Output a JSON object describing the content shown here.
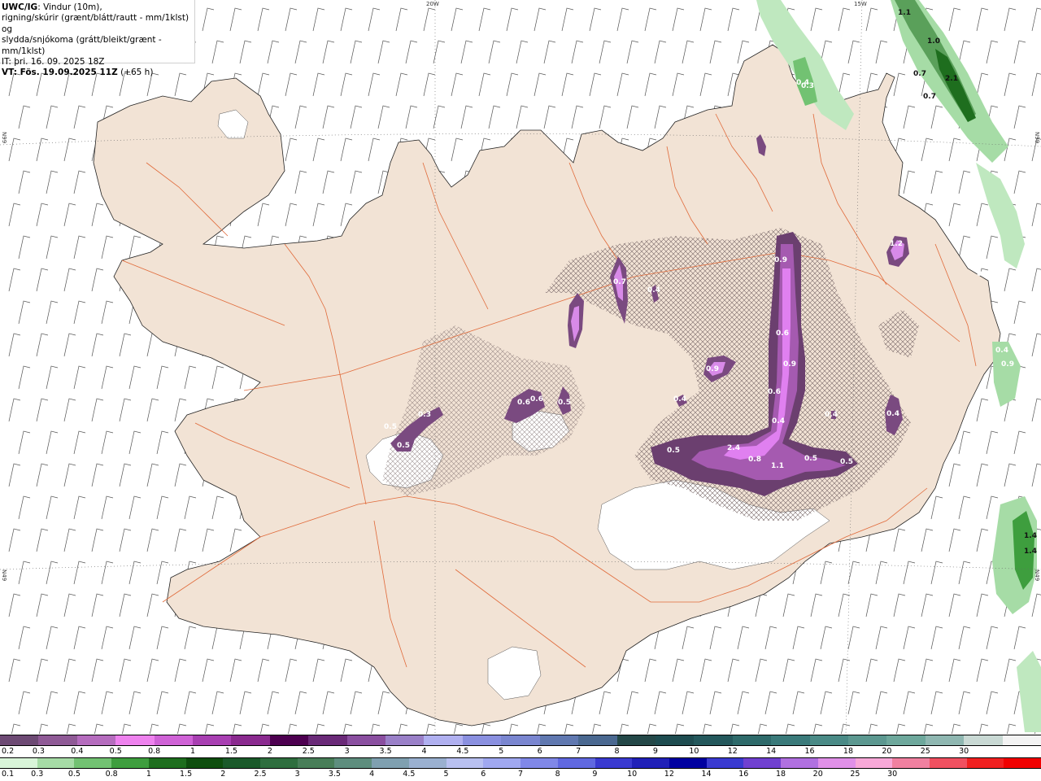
{
  "title": {
    "model": "UWC/IG",
    "line1_rest": ": Vindur (10m),",
    "line2": "rigning/skúrir (grænt/blátt/rautt - mm/1klst) og",
    "line3": "slydda/snjókoma (grátt/bleikt/grænt - mm/1klst)",
    "line4": "IT: þri. 16. 09. 2025 18Z",
    "line5_bold": "VT: Fös. 19.09.2025 11Z",
    "line5_rest": " (+65 h)"
  },
  "coords": {
    "lon_20w": "20W",
    "lon_15w": "15W",
    "lat_66n_left": "N99",
    "lat_66n_right": "N99",
    "lat_64n_left": "N49",
    "lat_64n_right": "N49"
  },
  "values": {
    "pink": [
      "0.9",
      "0.7",
      "0.6",
      "1.2",
      "0.9",
      "0.6",
      "0.4",
      "0.3",
      "0.5",
      "0.6",
      "0.5",
      "0.5",
      "0.9",
      "0.4",
      "0.6",
      "0.4",
      "0.4",
      "0.5",
      "2.4",
      "0.8",
      "1.1",
      "0.5",
      "0.5",
      "0.8",
      "0.9",
      "0.4",
      "0.4",
      "0.4",
      "0.3"
    ],
    "green": [
      "1.1",
      "1.0",
      "0.7",
      "2.1",
      "0.7",
      "1.4",
      "1.4"
    ]
  },
  "legend_snow": {
    "colors": [
      "#6d4a74",
      "#8f5a96",
      "#b56cbe",
      "#ee82ee",
      "#cf62d6",
      "#a83fb2",
      "#8a2a8f",
      "#4d0050",
      "#6a2a78",
      "#8a4fa0",
      "#9a80c8",
      "#b0b0f0",
      "#8a90e0",
      "#7a86d0",
      "#6078b0",
      "#4a6890",
      "#244848",
      "#1e4c50",
      "#24585c",
      "#2e6a6a",
      "#3a7a7a",
      "#4a8a86",
      "#5c9890",
      "#6ea89c",
      "#8fb7b1",
      "#c9d9d4",
      "#f3f3f3"
    ],
    "labels": [
      "0.2",
      "0.3",
      "0.4",
      "0.5",
      "0.8",
      "1",
      "1.5",
      "2",
      "2.5",
      "3",
      "3.5",
      "4",
      "4.5",
      "5",
      "6",
      "7",
      "8",
      "9",
      "10",
      "12",
      "14",
      "16",
      "18",
      "20",
      "25",
      "30"
    ]
  },
  "legend_rain": {
    "colors": [
      "#d9f5d9",
      "#a6dca6",
      "#72c272",
      "#3e9e3e",
      "#1e6e1e",
      "#0e4e0e",
      "#1a5a2a",
      "#2e6e3e",
      "#487e58",
      "#5e8e7e",
      "#7fa0b0",
      "#9ab0d0",
      "#b8c0f0",
      "#a0a8f0",
      "#8088e8",
      "#6068e0",
      "#3a3ad0",
      "#2020b8",
      "#0000a0",
      "#3a3ad0",
      "#7040d0",
      "#b070e0",
      "#e090e8",
      "#f8a8d8",
      "#f080a0",
      "#f05060",
      "#f02020",
      "#f00000"
    ],
    "labels": [
      "0.1",
      "0.3",
      "0.5",
      "0.8",
      "1",
      "1.5",
      "2",
      "2.5",
      "3",
      "3.5",
      "4",
      "4.5",
      "5",
      "6",
      "7",
      "8",
      "9",
      "10",
      "12",
      "14",
      "16",
      "18",
      "20",
      "25",
      "30"
    ]
  }
}
